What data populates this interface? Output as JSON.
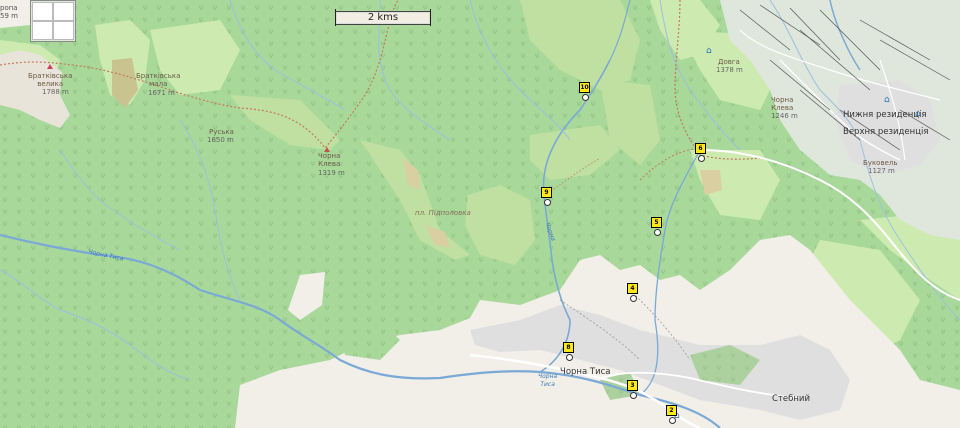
{
  "scale_label": "2 kms",
  "colors": {
    "forest": "#a9d89b",
    "meadow": "#cdebb0",
    "grass": "#bfe0a1",
    "scrub": "#c8d7a0",
    "village": "#e0dfdf",
    "land": "#f2efe9",
    "bare": "#d9cfa0",
    "water": "#aad3df",
    "stream": "#7aa9d6",
    "path": "#c27a5c",
    "road": "#ffffff",
    "waypoint": "#ffe81a",
    "resort": "#dfe7dc"
  },
  "labels": {
    "top_left": "ропа\n59 m",
    "bratkivska_velyka": "Братківська\nвелика",
    "bratkivska_velyka_elev": "1788 m",
    "bratkivska_mala": "Братківська\nмала",
    "bratkivska_mala_elev": "1671 m",
    "ruska": "Руська",
    "ruska_elev": "1650 m",
    "chorna_kleva": "Чорна\nКлева",
    "chorna_kleva_elev": "1319 m",
    "pidpolovka": "пл. Підполовка",
    "dovha": "Довга",
    "dovha_elev": "1378 m",
    "chorna_kleva2": "Чорна\nКлева",
    "chorna_kleva2_elev": "1246 m",
    "bukovel": "Буковель",
    "bukovel_elev": "1127 m",
    "nyzhnia": "Нижня резиденція",
    "verkhnia": "Верхня резиденція",
    "chorna_tysa_village": "Чорна Тиса",
    "chorna_tysa_river": "Чорна\nТиса",
    "stebnyi": "Стебний",
    "river_tysa_left": "Чорна Тиса",
    "river_mid": "Чорна"
  },
  "waypoints": [
    "10",
    "9",
    "6",
    "5",
    "4",
    "8",
    "3",
    "2"
  ]
}
